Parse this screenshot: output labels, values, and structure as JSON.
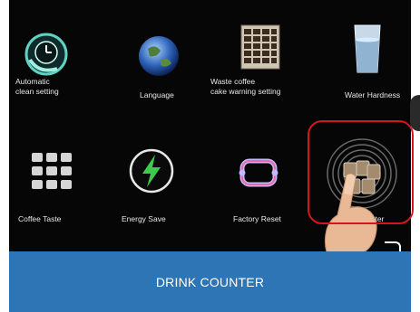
{
  "tiles": [
    {
      "label": "Automatic\nclean setting",
      "icon": "clean-clock-icon"
    },
    {
      "label": "Language",
      "icon": "globe-icon"
    },
    {
      "label": "Waste coffee\ncake warning setting",
      "icon": "coffee-grounds-bin-icon"
    },
    {
      "label": "Water Hardness",
      "icon": "water-glass-icon"
    },
    {
      "label": "Coffee Taste",
      "icon": "keypad-grid-icon"
    },
    {
      "label": "Energy Save",
      "icon": "lightning-icon"
    },
    {
      "label": "Factory Reset",
      "icon": "reset-frame-icon"
    },
    {
      "label": "unter",
      "icon": "drink-counter-cups-icon"
    }
  ],
  "banner": {
    "label": "DRINK COUNTER"
  },
  "colors": {
    "banner": "#2e75b6",
    "highlight": "#d8141f",
    "screen": "#060606"
  }
}
